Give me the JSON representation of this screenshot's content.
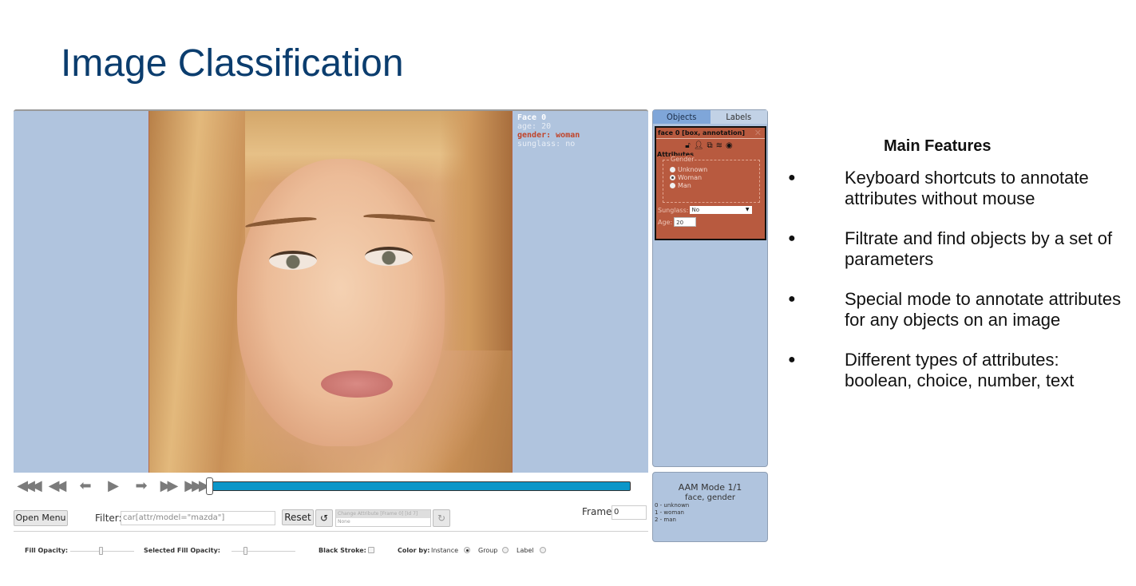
{
  "slide": {
    "title": "Image Classification"
  },
  "canvas": {
    "object_label": {
      "title": "Face 0",
      "lines": [
        "age: 20",
        "gender: woman",
        "sunglass: no"
      ]
    }
  },
  "side_panel": {
    "tabs": [
      {
        "label": "Objects",
        "active": true
      },
      {
        "label": "Labels",
        "active": false
      }
    ],
    "object_card": {
      "header": "face 0 [box, annotation]",
      "close_icon": "close-icon",
      "icons": [
        "lock-icon",
        "person-icon",
        "copy-icon",
        "layers-icon",
        "target-icon"
      ],
      "attributes_title": "Attributes",
      "gender": {
        "legend": "Gender",
        "options": [
          "Unknown",
          "Woman",
          "Man"
        ],
        "selected": "Woman"
      },
      "sunglass": {
        "label": "Sunglass:",
        "value": "No"
      },
      "age": {
        "label": "Age:",
        "value": "20"
      },
      "color": "#b85a3f"
    }
  },
  "aam_panel": {
    "title": "AAM Mode 1/1",
    "subtitle": "face, gender",
    "keys": [
      "0 - unknown",
      "1 - woman",
      "2 - man"
    ]
  },
  "player": {
    "buttons": [
      "first-icon",
      "prev-step-icon",
      "prev-icon",
      "play-icon",
      "next-icon",
      "next-step-icon",
      "last-icon"
    ],
    "glyphs": [
      "◀◀◀",
      "◀◀",
      "⬅",
      "▶",
      "➡",
      "▶▶",
      "▶▶▶"
    ],
    "progress_fraction": 0.0
  },
  "toolbar": {
    "open_menu_label": "Open Menu",
    "filter_label": "Filter:",
    "filter_placeholder": "car[attr/model=\"mazda\"]",
    "reset_label": "Reset",
    "undo_glyph": "↺",
    "redo_glyph": "↻",
    "history_top": "Change Attribute [Frame 0] [Id 7]",
    "history_bottom": "None",
    "frame_label": "Frame",
    "frame_value": "0"
  },
  "settings": {
    "fill_opacity_label": "Fill Opacity:",
    "selected_fill_opacity_label": "Selected Fill Opacity:",
    "black_stroke_label": "Black Stroke:",
    "color_by_label": "Color by:",
    "color_by_options": [
      "Instance",
      "Group",
      "Label"
    ],
    "color_by_selected": "Instance"
  },
  "features": {
    "title": "Main Features",
    "items": [
      "Keyboard shortcuts to annotate attributes without mouse",
      "Filtrate and find objects by a set of parameters",
      "Special mode to annotate attributes for any objects on an image",
      "Different types of attributes: boolean, choice, number, text"
    ]
  }
}
